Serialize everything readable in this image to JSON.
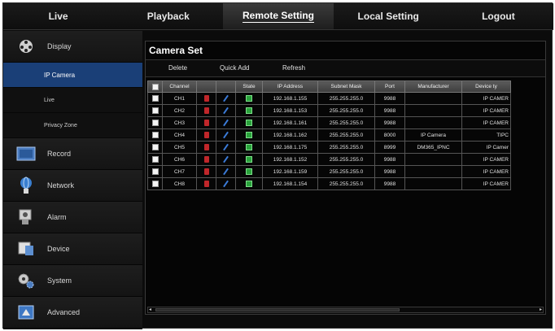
{
  "nav": {
    "tabs": [
      "Live",
      "Playback",
      "Remote Setting",
      "Local Setting",
      "Logout"
    ]
  },
  "sidebar": {
    "items": [
      {
        "label": "Display",
        "icon": "film-reel-icon"
      },
      {
        "label": "IP Camera"
      },
      {
        "label": "Live"
      },
      {
        "label": "Privacy Zone"
      },
      {
        "label": "Record",
        "icon": "record-icon"
      },
      {
        "label": "Network",
        "icon": "network-globe-icon"
      },
      {
        "label": "Alarm",
        "icon": "alarm-icon"
      },
      {
        "label": "Device",
        "icon": "device-icon"
      },
      {
        "label": "System",
        "icon": "system-gears-icon"
      },
      {
        "label": "Advanced",
        "icon": "advanced-icon"
      }
    ]
  },
  "panel": {
    "title": "Camera Set",
    "toolbar": {
      "delete": "Delete",
      "quick_add": "Quick Add",
      "refresh": "Refresh"
    }
  },
  "table": {
    "headers": [
      "Channel",
      "",
      "",
      "State",
      "IP Address",
      "Subnet Mask",
      "Port",
      "Manufacturer",
      "Device ty"
    ],
    "rows": [
      {
        "ch": "CH1",
        "ip": "192.168.1.155",
        "mask": "255.255.255.0",
        "port": "9988",
        "man": "",
        "dev": "IP CAMER"
      },
      {
        "ch": "CH2",
        "ip": "192.168.1.153",
        "mask": "255.255.255.0",
        "port": "9988",
        "man": "",
        "dev": "IP CAMER"
      },
      {
        "ch": "CH3",
        "ip": "192.168.1.161",
        "mask": "255.255.255.0",
        "port": "9988",
        "man": "",
        "dev": "IP CAMER"
      },
      {
        "ch": "CH4",
        "ip": "192.168.1.162",
        "mask": "255.255.255.0",
        "port": "8000",
        "man": "IP Camera",
        "dev": "TIPC"
      },
      {
        "ch": "CH5",
        "ip": "192.168.1.175",
        "mask": "255.255.255.0",
        "port": "8999",
        "man": "DM365_IPNC",
        "dev": "IP Camer"
      },
      {
        "ch": "CH6",
        "ip": "192.168.1.152",
        "mask": "255.255.255.0",
        "port": "9988",
        "man": "",
        "dev": "IP CAMER"
      },
      {
        "ch": "CH7",
        "ip": "192.168.1.159",
        "mask": "255.255.255.0",
        "port": "9988",
        "man": "",
        "dev": "IP CAMER"
      },
      {
        "ch": "CH8",
        "ip": "192.168.1.154",
        "mask": "255.255.255.0",
        "port": "9988",
        "man": "",
        "dev": "IP CAMER"
      }
    ]
  },
  "colors": {
    "selected_item": "#1a3f77",
    "state_ok": "#2aa33c",
    "delete": "#c0262a",
    "edit": "#3b7bd8"
  }
}
